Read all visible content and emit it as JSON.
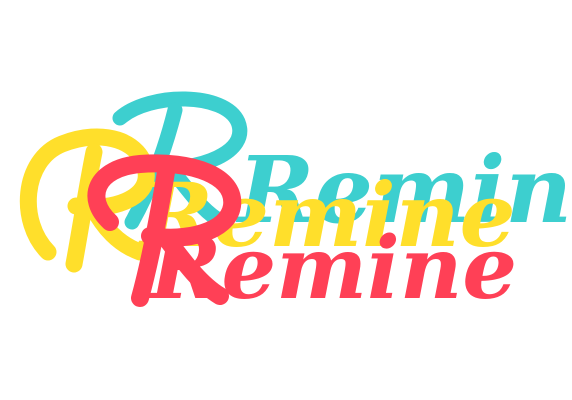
{
  "logo": {
    "text": "Remine",
    "style": "disco",
    "colors": {
      "back": "#3dcfcf",
      "middle": "#ffdf2b",
      "front": "#ff4056",
      "background": "#ffffff"
    }
  }
}
